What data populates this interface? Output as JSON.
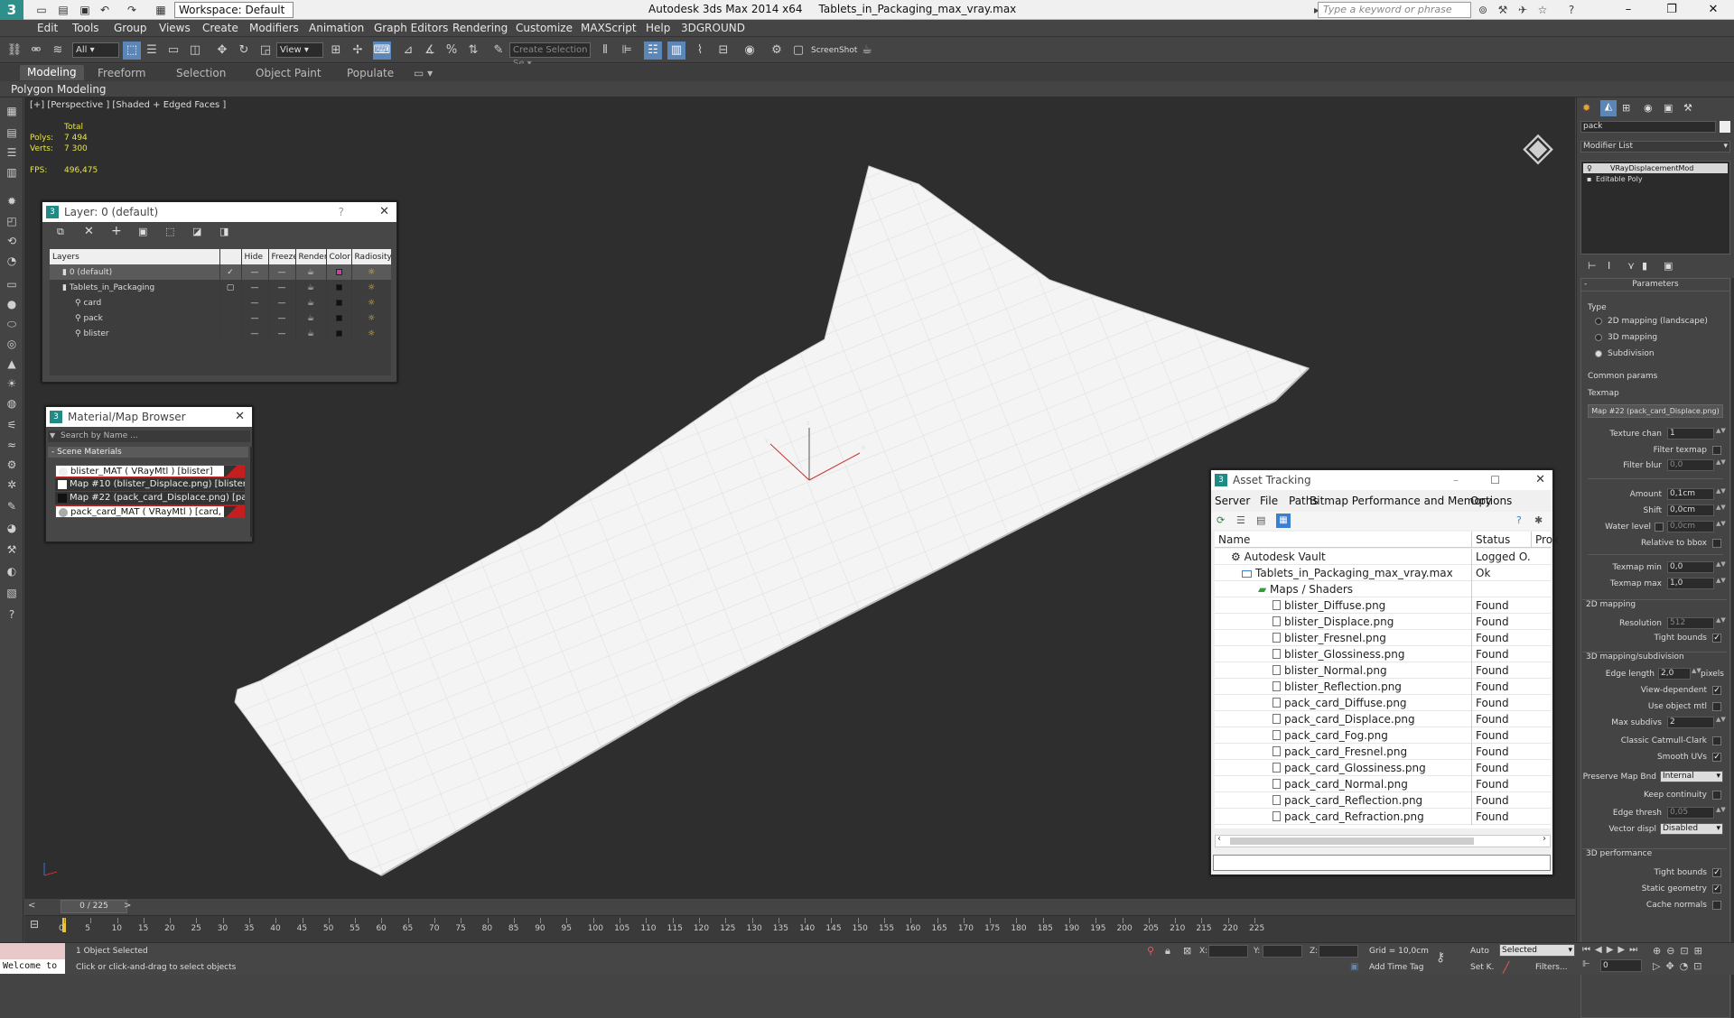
{
  "window": {
    "app_title": "Autodesk 3ds Max  2014 x64",
    "file_title": "Tablets_in_Packaging_max_vray.max",
    "workspace": "Workspace: Default",
    "search_placeholder": "Type a keyword or phrase"
  },
  "menu": [
    "Edit",
    "Tools",
    "Group",
    "Views",
    "Create",
    "Modifiers",
    "Animation",
    "Graph Editors",
    "Rendering",
    "Customize",
    "MAXScript",
    "Help",
    "3DGROUND"
  ],
  "toolbar": {
    "selection_filter": "All",
    "ref_coord": "View",
    "named_selection_placeholder": "Create Selection Se",
    "screenshot_label": "ScreenShot"
  },
  "ribbon": {
    "tabs": [
      "Modeling",
      "Freeform",
      "Selection",
      "Object Paint",
      "Populate"
    ],
    "active_tab": "Modeling",
    "sub_label": "Polygon Modeling"
  },
  "viewport": {
    "label": "[+] [Perspective ] [Shaded + Edged Faces ]",
    "stats_total": "Total",
    "polys_label": "Polys:",
    "polys_value": "7 494",
    "verts_label": "Verts:",
    "verts_value": "7 300",
    "fps_label": "FPS:",
    "fps_value": "496,475",
    "axis_x": "x",
    "axis_y": "y",
    "axis_z": "z"
  },
  "layer_window": {
    "title": "Layer: 0 (default)",
    "question": "?",
    "columns": [
      "Layers",
      "Hide",
      "Freeze",
      "Render",
      "Color",
      "Radiosity"
    ],
    "rows": [
      {
        "name": "0 (default)",
        "current": "✓",
        "color": "#d23aa8"
      },
      {
        "name": "Tablets_in_Packaging",
        "current": "▢",
        "color": "#111111"
      },
      {
        "name": "card",
        "current": "",
        "color": "#111111"
      },
      {
        "name": "pack",
        "current": "",
        "color": "#111111"
      },
      {
        "name": "blister",
        "current": "",
        "color": "#111111"
      }
    ],
    "dash": "—"
  },
  "material_browser": {
    "title": "Material/Map Browser",
    "search_placeholder": "Search by Name ...",
    "section": "- Scene Materials",
    "items": [
      "blister_MAT  ( VRayMtl )  [blister]",
      "Map #10 (blister_Displace.png)  [blister]",
      "Map #22 (pack_card_Displace.png)  [pack]",
      "pack_card_MAT  ( VRayMtl )  [card, pack]"
    ]
  },
  "asset_tracking": {
    "title": "Asset Tracking",
    "menu": [
      "Server",
      "File",
      "Paths",
      "Bitmap Performance and Memory",
      "Options"
    ],
    "columns": [
      "Name",
      "Status",
      "Prox"
    ],
    "rows": [
      {
        "name": "Autodesk Vault",
        "status": "Logged O..."
      },
      {
        "name": "Tablets_in_Packaging_max_vray.max",
        "status": "Ok"
      },
      {
        "name": "Maps / Shaders",
        "status": ""
      },
      {
        "name": "blister_Diffuse.png",
        "status": "Found"
      },
      {
        "name": "blister_Displace.png",
        "status": "Found"
      },
      {
        "name": "blister_Fresnel.png",
        "status": "Found"
      },
      {
        "name": "blister_Glossiness.png",
        "status": "Found"
      },
      {
        "name": "blister_Normal.png",
        "status": "Found"
      },
      {
        "name": "blister_Reflection.png",
        "status": "Found"
      },
      {
        "name": "pack_card_Diffuse.png",
        "status": "Found"
      },
      {
        "name": "pack_card_Displace.png",
        "status": "Found"
      },
      {
        "name": "pack_card_Fog.png",
        "status": "Found"
      },
      {
        "name": "pack_card_Fresnel.png",
        "status": "Found"
      },
      {
        "name": "pack_card_Glossiness.png",
        "status": "Found"
      },
      {
        "name": "pack_card_Normal.png",
        "status": "Found"
      },
      {
        "name": "pack_card_Reflection.png",
        "status": "Found"
      },
      {
        "name": "pack_card_Refraction.png",
        "status": "Found"
      }
    ]
  },
  "command_panel": {
    "object_name": "pack",
    "modifier_list": "Modifier List",
    "stack": [
      "VRayDisplacementMod",
      "Editable Poly"
    ],
    "parameters": "Parameters",
    "type_label": "Type",
    "type_options": [
      "2D mapping (landscape)",
      "3D mapping",
      "Subdivision"
    ],
    "selected_type": "Subdivision",
    "common_params": "Common params",
    "texmap_label": "Texmap",
    "texmap_value": "Map #22 (pack_card_Displace.png)",
    "texture_chan_label": "Texture chan",
    "texture_chan_value": "1",
    "filter_texmap": "Filter texmap",
    "filter_blur_label": "Filter blur",
    "filter_blur_value": "0,0",
    "amount_label": "Amount",
    "amount_value": "0,1cm",
    "shift_label": "Shift",
    "shift_value": "0,0cm",
    "water_level_label": "Water level",
    "water_level_value": "0,0cm",
    "relative_bbox": "Relative to bbox",
    "texmap_min_label": "Texmap min",
    "texmap_min_value": "0,0",
    "texmap_max_label": "Texmap max",
    "texmap_max_value": "1,0",
    "mapping2d_header": "2D mapping",
    "resolution_label": "Resolution",
    "resolution_value": "512",
    "tight_bounds": "Tight bounds",
    "mapping3d_header": "3D mapping/subdivision",
    "edge_length_label": "Edge length",
    "edge_length_value": "2,0",
    "pixels_label": "pixels",
    "view_dependent": "View-dependent",
    "use_object_mtl": "Use object mtl",
    "max_subdivs_label": "Max subdivs",
    "max_subdivs_value": "2",
    "classic_catmull": "Classic Catmull-Clark",
    "smooth_uvs": "Smooth UVs",
    "preserve_map_bnd_label": "Preserve Map Bnd",
    "preserve_map_bnd_value": "Internal",
    "keep_continuity": "Keep continuity",
    "edge_thresh_label": "Edge thresh",
    "edge_thresh_value": "0,05",
    "vector_displ_label": "Vector displ",
    "vector_displ_value": "Disabled",
    "perf_header": "3D performance",
    "perf_tight_bounds": "Tight bounds",
    "static_geometry": "Static geometry",
    "cache_normals": "Cache normals"
  },
  "timeline": {
    "frame": "0 / 225",
    "ticks": [
      "0",
      "5",
      "10",
      "15",
      "20",
      "25",
      "30",
      "35",
      "40",
      "45",
      "50",
      "55",
      "60",
      "65",
      "70",
      "75",
      "80",
      "85",
      "90",
      "95",
      "100",
      "105",
      "110",
      "115",
      "120",
      "125",
      "130",
      "135",
      "140",
      "145",
      "150",
      "155",
      "160",
      "165",
      "170",
      "175",
      "180",
      "185",
      "190",
      "195",
      "200",
      "205",
      "210",
      "215",
      "220",
      "225"
    ]
  },
  "status": {
    "maxscript": "Welcome to",
    "selected": "1 Object Selected",
    "prompt": "Click or click-and-drag to select objects",
    "x_label": "X:",
    "y_label": "Y:",
    "z_label": "Z:",
    "grid": "Grid = 10,0cm",
    "add_time_tag": "Add Time Tag",
    "auto": "Auto",
    "selected_dd": "Selected",
    "set_k": "Set K.",
    "filters": "Filters...",
    "frame_value": "0"
  }
}
